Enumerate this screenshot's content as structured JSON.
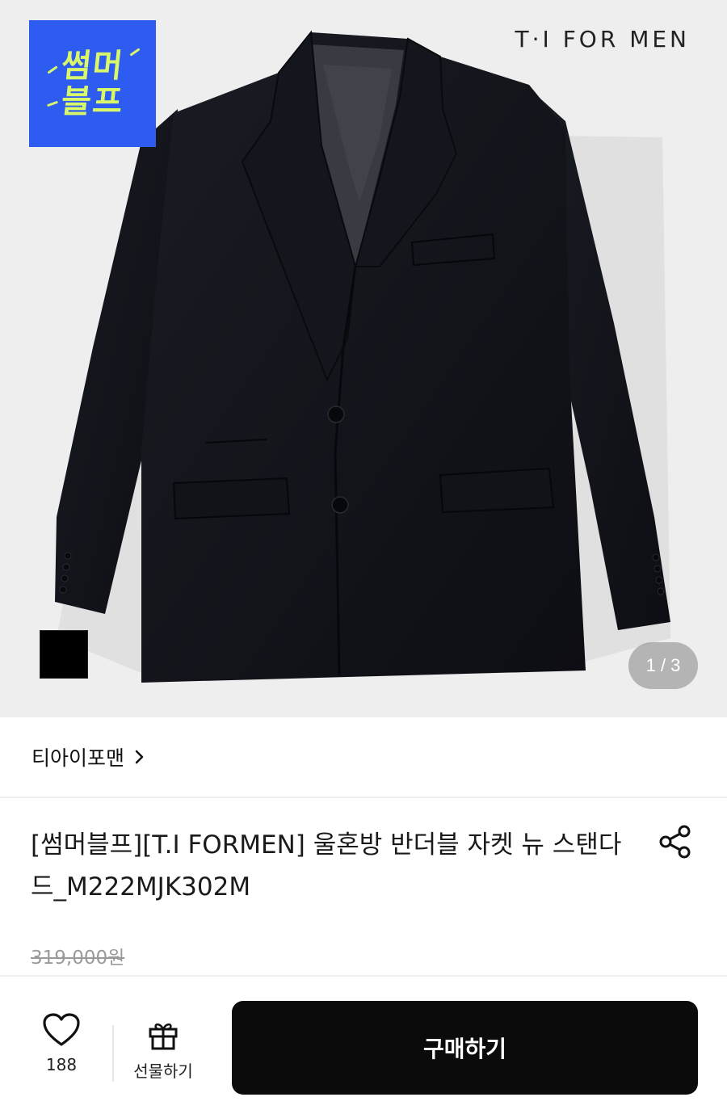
{
  "hero": {
    "promo_badge": {
      "line1": "썸머",
      "line2": "블프",
      "bg_color": "#2e5bf0",
      "text_color": "#d8f86a"
    },
    "brand_logo": "T·I FOR MEN",
    "color_swatch": {
      "color": "#000000"
    },
    "image_counter": "1 / 3"
  },
  "brand": {
    "name": "티아이포맨",
    "chevron_icon": "chevron-right-icon"
  },
  "product": {
    "title": "[썸머블프][T.I FORMEN] 울혼방 반더블 자켓 뉴 스탠다드_M222MJK302M",
    "share_icon": "share-icon",
    "original_price": "319,000원"
  },
  "bottom_bar": {
    "like_icon": "heart-icon",
    "like_count": "188",
    "gift_icon": "gift-icon",
    "gift_label": "선물하기",
    "buy_label": "구매하기",
    "buy_color": "#0b0b0b"
  }
}
